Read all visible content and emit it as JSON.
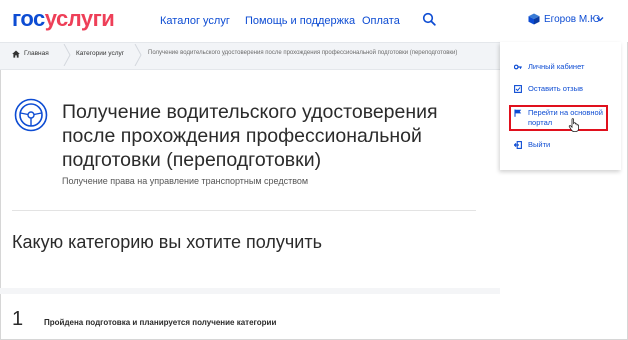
{
  "header": {
    "logo_part1": "гос",
    "logo_part2": "услуги",
    "nav": [
      "Каталог услуг",
      "Помощь и поддержка",
      "Оплата"
    ],
    "user_name": "Егоров М.Ю"
  },
  "breadcrumb": [
    "Главная",
    "Категории услуг",
    "Получение водительского удостоверения после прохождения профессиональной подготовки (переподготовки)"
  ],
  "service": {
    "title": "Получение водительского удостоверения после прохождения профессиональной подготовки (переподготовки)",
    "subtitle": "Получение права на управление транспортным средством"
  },
  "question": "Какую категорию вы хотите получить",
  "step": {
    "number": "1",
    "text": "Пройдена подготовка и планируется получение категории"
  },
  "user_menu": {
    "items": [
      {
        "label": "Личный кабинет",
        "icon": "key-icon"
      },
      {
        "label": "Оставить отзыв",
        "icon": "feedback-icon"
      },
      {
        "label": "Перейти на основной портал",
        "icon": "flag-icon"
      },
      {
        "label": "Выйти",
        "icon": "logout-icon"
      }
    ]
  },
  "colors": {
    "brand_blue": "#0d4cd3",
    "brand_red": "#ee3f58",
    "highlight": "#e0101d"
  }
}
